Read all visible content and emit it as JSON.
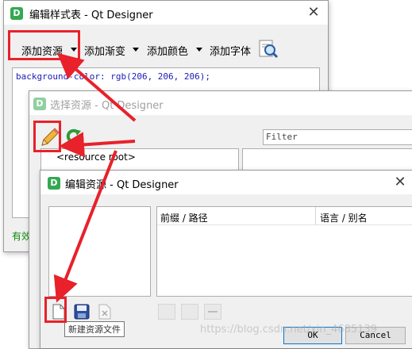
{
  "style_window": {
    "title": "编辑样式表 - Qt Designer",
    "logo": "D",
    "close": "✕",
    "toolbar": [
      "添加资源",
      "添加渐变",
      "添加颜色",
      "添加字体"
    ],
    "code": "background-color: rgb(206, 206, 206);",
    "status": "有效"
  },
  "select_window": {
    "title": "选择资源 - Qt Designer",
    "logo": "D",
    "filter_placeholder": "Filter",
    "tree_root": "<resource root>"
  },
  "edit_window": {
    "title": "编辑资源 - Qt Designer",
    "logo": "D",
    "close": "✕",
    "col_prefix": "前缀 / 路径",
    "col_lang": "语言 / 别名",
    "tooltip": "新建资源文件",
    "ok": "OK",
    "cancel": "Cancel"
  },
  "watermark": "https://blog.csdn.net/xin_4685139",
  "icons": {
    "edit": "pencil-icon",
    "reload": "reload-icon",
    "font_preview": "magnifier-icon",
    "new_file": "new-file-icon",
    "save": "save-icon",
    "remove": "remove-file-icon",
    "add_prefix": "add-prefix-icon",
    "add_files": "add-files-icon",
    "minus": "minus-icon"
  },
  "colors": {
    "annotation_red": "#e8212a",
    "qt_green": "#34a853"
  }
}
